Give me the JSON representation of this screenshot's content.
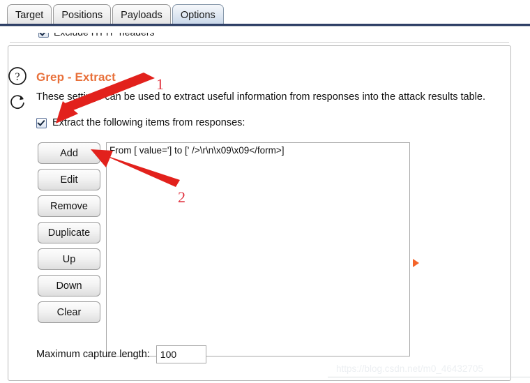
{
  "window": {
    "tabs": [
      {
        "label": "Target",
        "selected": false
      },
      {
        "label": "Positions",
        "selected": false
      },
      {
        "label": "Payloads",
        "selected": false
      },
      {
        "label": "Options",
        "selected": true
      }
    ]
  },
  "clipped_section": {
    "checkbox_label": "Exclude HTTP headers"
  },
  "grep_extract": {
    "help_icon": "question-circle-icon",
    "refresh_icon": "refresh-circular-arrow-icon",
    "title": "Grep - Extract",
    "description": "These settings can be used to extract useful information from responses into the attack results table.",
    "enable_checkbox": {
      "label": "Extract the following items from responses:",
      "checked": true
    },
    "buttons": [
      "Add",
      "Edit",
      "Remove",
      "Duplicate",
      "Up",
      "Down",
      "Clear"
    ],
    "items": [
      "From [ value='] to [' />\\r\\n\\x09\\x09</form>]"
    ],
    "right_marker_icon": "orange-right-triangle-icon",
    "max_capture": {
      "label": "Maximum capture length:",
      "value": "100"
    }
  },
  "annotations": {
    "arrow1_label": "1",
    "arrow2_label": "2",
    "color": "#e0303c"
  },
  "watermark": {
    "text": "https://blog.csdn.net/m0_46432705"
  },
  "colors": {
    "heading": "#e8703a",
    "tab_selected": "#c7d6e8",
    "tab_underline": "#2e3f66",
    "annotation_red": "#e0303c",
    "marker_orange": "#f4642a"
  }
}
